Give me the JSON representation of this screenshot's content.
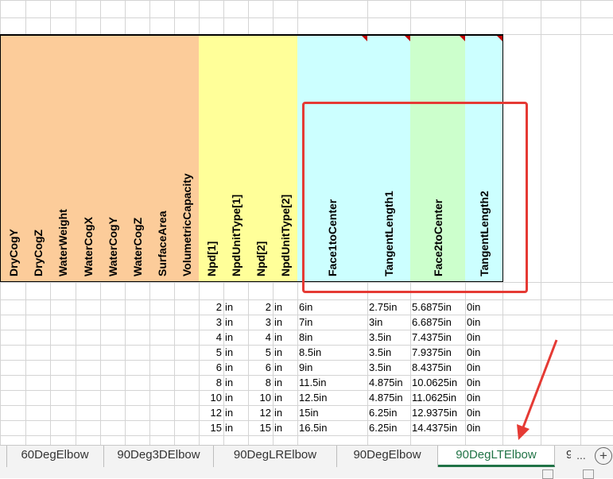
{
  "columns": [
    {
      "label": "DryCogY",
      "color": "#fccc9a"
    },
    {
      "label": "DryCogZ",
      "color": "#fccc9a"
    },
    {
      "label": "WaterWeight",
      "color": "#fccc9a"
    },
    {
      "label": "WaterCogX",
      "color": "#fccc9a"
    },
    {
      "label": "WaterCogY",
      "color": "#fccc9a"
    },
    {
      "label": "WaterCogZ",
      "color": "#fccc9a"
    },
    {
      "label": "SurfaceArea",
      "color": "#fccc9a"
    },
    {
      "label": "VolumetricCapacity",
      "color": "#fccc9a"
    },
    {
      "label": "Npd[1]",
      "color": "#ffff99"
    },
    {
      "label": "NpdUnitType[1]",
      "color": "#ffff99"
    },
    {
      "label": "Npd[2]",
      "color": "#ffff99"
    },
    {
      "label": "NpdUnitType[2]",
      "color": "#ffff99"
    },
    {
      "label": "Face1toCenter",
      "color": "#ccffff"
    },
    {
      "label": "TangentLength1",
      "color": "#ccffff"
    },
    {
      "label": "Face2toCenter",
      "color": "#ccffcc"
    },
    {
      "label": "TangentLength2",
      "color": "#ccffff"
    }
  ],
  "rows": [
    [
      "2",
      "in",
      "2",
      "in",
      "6in",
      "2.75in",
      "5.6875in",
      "0in"
    ],
    [
      "3",
      "in",
      "3",
      "in",
      "7in",
      "3in",
      "6.6875in",
      "0in"
    ],
    [
      "4",
      "in",
      "4",
      "in",
      "8in",
      "3.5in",
      "7.4375in",
      "0in"
    ],
    [
      "5",
      "in",
      "5",
      "in",
      "8.5in",
      "3.5in",
      "7.9375in",
      "0in"
    ],
    [
      "6",
      "in",
      "6",
      "in",
      "9in",
      "3.5in",
      "8.4375in",
      "0in"
    ],
    [
      "8",
      "in",
      "8",
      "in",
      "11.5in",
      "4.875in",
      "10.0625in",
      "0in"
    ],
    [
      "10",
      "in",
      "10",
      "in",
      "12.5in",
      "4.875in",
      "11.0625in",
      "0in"
    ],
    [
      "12",
      "in",
      "12",
      "in",
      "15in",
      "6.25in",
      "12.9375in",
      "0in"
    ],
    [
      "15",
      "in",
      "15",
      "in",
      "16.5in",
      "6.25in",
      "14.4375in",
      "0in"
    ]
  ],
  "tabs": [
    {
      "label": "60DegElbow",
      "active": false
    },
    {
      "label": "90Deg3DElbow",
      "active": false
    },
    {
      "label": "90DegLRElbow",
      "active": false
    },
    {
      "label": "90DegElbow",
      "active": false
    },
    {
      "label": "90DegLTElbow",
      "active": true
    },
    {
      "label": "9",
      "active": false
    }
  ],
  "tab_nav": {
    "more": "...",
    "add": "+"
  },
  "annotation_color": "#e53a34",
  "active_tab_color": "#217346"
}
